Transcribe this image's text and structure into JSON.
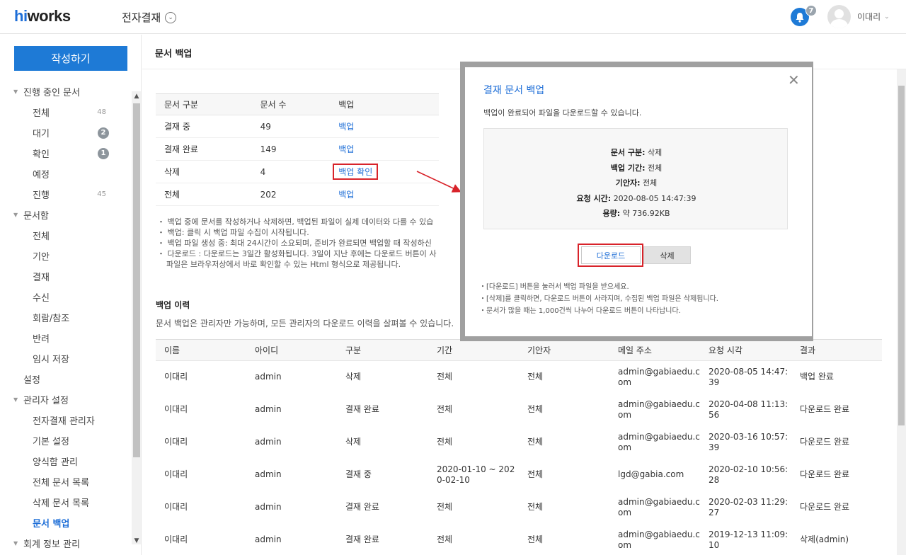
{
  "header": {
    "logo_hi": "hi",
    "logo_rest": "works",
    "app_title": "전자결재",
    "notification_count": "7",
    "user_name": "이대리"
  },
  "sidebar": {
    "write_button": "작성하기",
    "items": [
      {
        "kind": "group",
        "label": "진행 중인 문서"
      },
      {
        "kind": "sub",
        "label": "전체",
        "count": "48"
      },
      {
        "kind": "sub",
        "label": "대기",
        "badge": "2"
      },
      {
        "kind": "sub",
        "label": "확인",
        "badge": "1"
      },
      {
        "kind": "sub",
        "label": "예정"
      },
      {
        "kind": "sub",
        "label": "진행",
        "count": "45"
      },
      {
        "kind": "group",
        "label": "문서함"
      },
      {
        "kind": "sub",
        "label": "전체"
      },
      {
        "kind": "sub",
        "label": "기안"
      },
      {
        "kind": "sub",
        "label": "결재"
      },
      {
        "kind": "sub",
        "label": "수신"
      },
      {
        "kind": "sub",
        "label": "회람/참조"
      },
      {
        "kind": "sub",
        "label": "반려"
      },
      {
        "kind": "sub",
        "label": "임시 저장"
      },
      {
        "kind": "plain",
        "label": "설정"
      },
      {
        "kind": "group",
        "label": "관리자 설정"
      },
      {
        "kind": "sub",
        "label": "전자결재 관리자"
      },
      {
        "kind": "sub",
        "label": "기본 설정"
      },
      {
        "kind": "sub",
        "label": "양식함 관리"
      },
      {
        "kind": "sub",
        "label": "전체 문서 목록"
      },
      {
        "kind": "sub",
        "label": "삭제 문서 목록"
      },
      {
        "kind": "sub",
        "label": "문서 백업",
        "active": true
      },
      {
        "kind": "group",
        "label": "회계 정보 관리"
      }
    ]
  },
  "main": {
    "title": "문서 백업",
    "summary": {
      "headers": [
        "문서 구분",
        "문서 수",
        "백업"
      ],
      "rows": [
        {
          "type": "결재 중",
          "count": "49",
          "action": "백업"
        },
        {
          "type": "결재 완료",
          "count": "149",
          "action": "백업"
        },
        {
          "type": "삭제",
          "count": "4",
          "action": "백업 확인",
          "highlight": true
        },
        {
          "type": "전체",
          "count": "202",
          "action": "백업"
        }
      ]
    },
    "notes": [
      "・ 백업 중에 문서를 작성하거나 삭제하면, 백업된 파일이 실제 데이터와 다를 수 있습",
      "・ 백업: 클릭 시 백업 파일 수집이 시작됩니다.",
      "・ 백업 파일 생성 중: 최대 24시간이 소요되며, 준비가 완료되면 백업할 때 작성하신 ",
      "・ 다운로드 : 다운로드는 3일간 활성화됩니다. 3일이 지난 후에는 다운로드 버튼이 사",
      "파일은 브라우저상에서 바로 확인할 수 있는 Html 형식으로 제공됩니다."
    ],
    "history_title": "백업 이력",
    "history_desc": "문서 백업은 관리자만 가능하며, 모든 관리자의 다운로드 이력을 살펴볼 수 있습니다.",
    "history": {
      "headers": [
        "이름",
        "아이디",
        "구분",
        "기간",
        "기안자",
        "메일 주소",
        "요청 시각",
        "결과"
      ],
      "rows": [
        [
          "이대리",
          "admin",
          "삭제",
          "전체",
          "전체",
          "admin@gabiaedu.com",
          "2020-08-05 14:47:39",
          "백업 완료"
        ],
        [
          "이대리",
          "admin",
          "결재 완료",
          "전체",
          "전체",
          "admin@gabiaedu.com",
          "2020-04-08 11:13:56",
          "다운로드 완료"
        ],
        [
          "이대리",
          "admin",
          "삭제",
          "전체",
          "전체",
          "admin@gabiaedu.com",
          "2020-03-16 10:57:39",
          "다운로드 완료"
        ],
        [
          "이대리",
          "admin",
          "결재 중",
          "2020-01-10 ~ 2020-02-10",
          "전체",
          "lgd@gabia.com",
          "2020-02-10 10:56:28",
          "다운로드 완료"
        ],
        [
          "이대리",
          "admin",
          "결재 완료",
          "전체",
          "전체",
          "admin@gabiaedu.com",
          "2020-02-03 11:29:27",
          "다운로드 완료"
        ],
        [
          "이대리",
          "admin",
          "결재 완료",
          "전체",
          "전체",
          "admin@gabiaedu.com",
          "2019-12-13 11:09:10",
          "삭제(admin)"
        ]
      ]
    }
  },
  "modal": {
    "title": "결재 문서 백업",
    "message": "백업이 완료되어 파일을 다운로드할 수 있습니다.",
    "info": [
      {
        "label": "문서 구분:",
        "value": "삭제"
      },
      {
        "label": "백업 기간:",
        "value": "전체"
      },
      {
        "label": "기안자:",
        "value": "전체"
      },
      {
        "label": "요청 시간:",
        "value": "2020-08-05 14:47:39"
      },
      {
        "label": "용량:",
        "value": "약 736.92KB"
      }
    ],
    "download_button": "다운로드",
    "delete_button": "삭제",
    "notes": [
      "・[다운로드] 버튼을 눌러서 백업 파일을 받으세요.",
      "・[삭제]를 클릭하면, 다운로드 버튼이 사라지며, 수집된 백업 파일은 삭제됩니다.",
      "・문서가 많을 때는 1,000건씩 나누어 다운로드 버튼이 나타납니다."
    ]
  },
  "colors": {
    "accent": "#1e7ad6",
    "highlight_red": "#d8232a"
  }
}
